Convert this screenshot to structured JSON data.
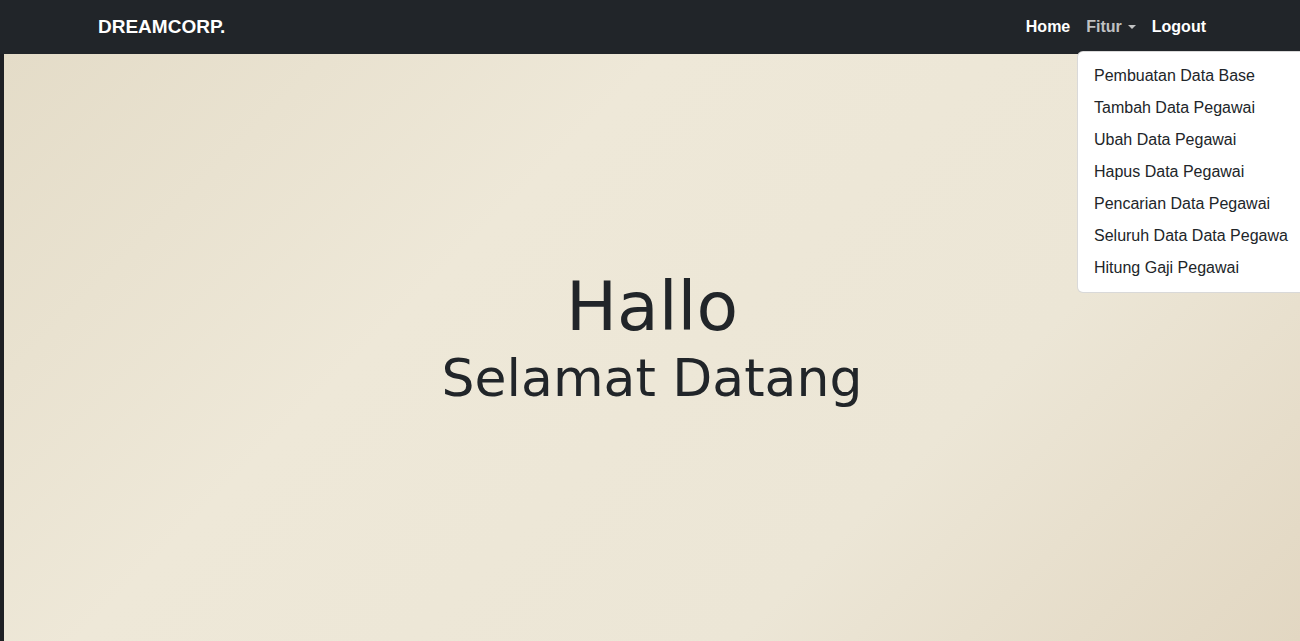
{
  "navbar": {
    "brand": "DREAMCORP.",
    "links": [
      {
        "label": "Home",
        "dropdown": false,
        "expanded": false
      },
      {
        "label": "Fitur",
        "dropdown": true,
        "expanded": true
      },
      {
        "label": "Logout",
        "dropdown": false,
        "expanded": false
      }
    ]
  },
  "dropdown_menu": {
    "items": [
      "Pembuatan Data Base",
      "Tambah Data Pegawai",
      "Ubah Data Pegawai",
      "Hapus Data Pegawai",
      "Pencarian Data Pegawai",
      "Seluruh Data Data Pegawa",
      "Hitung Gaji Pegawai"
    ]
  },
  "hero": {
    "title": "Hallo",
    "subtitle": "Selamat Datang"
  }
}
